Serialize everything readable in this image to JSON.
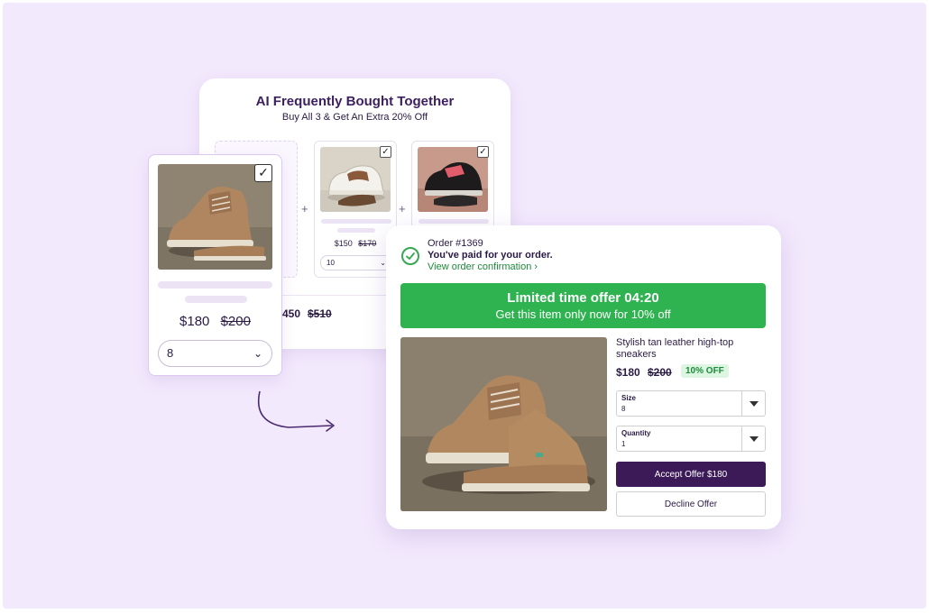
{
  "colors": {
    "background": "#f3e9fd",
    "brand_purple": "#3b1a57",
    "success_green": "#2fb350",
    "link_green": "#1f8a3b"
  },
  "fbt": {
    "title": "AI Frequently Bought Together",
    "subtitle": "Buy All 3 & Get An Extra 20% Off",
    "items": [
      {
        "price": "$150",
        "was": "$170",
        "size": "10",
        "checked": true,
        "image": "white-sneaker-image"
      },
      {
        "price": "",
        "was": "",
        "size": "",
        "checked": true,
        "image": "black-sneaker-image"
      }
    ],
    "total_now": "450",
    "total_was": "$510"
  },
  "product_card": {
    "price": "$180",
    "was": "$200",
    "size": "8",
    "checked": true,
    "image": "tan-suede-high-top-image"
  },
  "offer": {
    "order_number": "Order #1369",
    "paid_text": "You've paid for your order.",
    "view_link": "View order confirmation ›",
    "banner_title": "Limited time offer 04:20",
    "banner_subtitle": "Get this item only now for 10% off",
    "product_name": "Stylish tan leather high-top sneakers",
    "price": "$180",
    "was": "$200",
    "badge": "10% OFF",
    "size_label": "Size",
    "size_value": "8",
    "quantity_label": "Quantity",
    "quantity_value": "1",
    "accept_label": "Accept Offer $180",
    "decline_label": "Decline Offer"
  },
  "icons": [
    "checkbox-check-icon",
    "chevron-down-icon",
    "plus-icon",
    "curved-arrow-icon",
    "check-circle-icon",
    "dropdown-caret-icon"
  ]
}
